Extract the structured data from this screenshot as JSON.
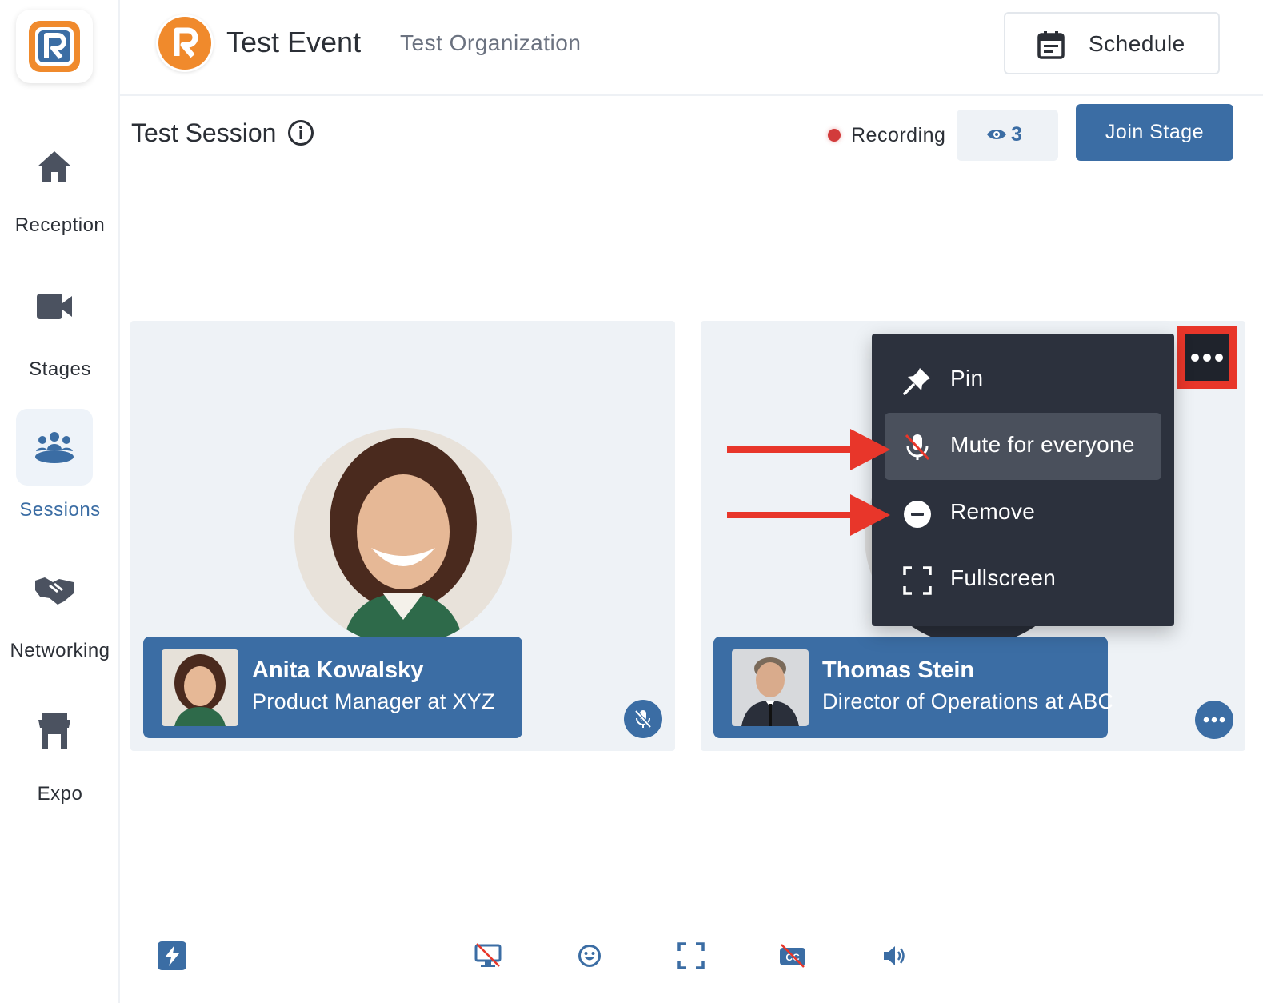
{
  "sidebar": {
    "items": [
      {
        "label": "Reception",
        "icon": "home-icon"
      },
      {
        "label": "Stages",
        "icon": "video-camera-icon"
      },
      {
        "label": "Sessions",
        "icon": "people-group-icon",
        "active": true
      },
      {
        "label": "Networking",
        "icon": "handshake-icon"
      },
      {
        "label": "Expo",
        "icon": "store-icon"
      }
    ]
  },
  "header": {
    "event_title": "Test Event",
    "organization": "Test Organization",
    "schedule_label": "Schedule"
  },
  "session": {
    "title": "Test Session",
    "recording_label": "Recording",
    "viewer_count": "3",
    "join_label": "Join Stage"
  },
  "participants": [
    {
      "name": "Anita Kowalsky",
      "title": "Product Manager at XYZ",
      "muted": true
    },
    {
      "name": "Thomas Stein",
      "title": "Director of Operations at ABC"
    }
  ],
  "context_menu": {
    "items": [
      {
        "label": "Pin",
        "icon": "pin-icon"
      },
      {
        "label": "Mute for everyone",
        "icon": "mic-off-icon",
        "highlighted": true
      },
      {
        "label": "Remove",
        "icon": "minus-circle-icon"
      },
      {
        "label": "Fullscreen",
        "icon": "fullscreen-icon"
      }
    ]
  },
  "colors": {
    "accent": "#3b6da4",
    "brand_orange": "#f08a2c",
    "annotation_red": "#e8362a",
    "menu_bg": "#2c313d",
    "recording_red": "#d23b3b"
  },
  "toolbar": {
    "icons": [
      "lightning-icon",
      "screen-share-off-icon",
      "emoji-icon",
      "fullscreen-icon",
      "captions-off-icon",
      "volume-icon"
    ]
  }
}
